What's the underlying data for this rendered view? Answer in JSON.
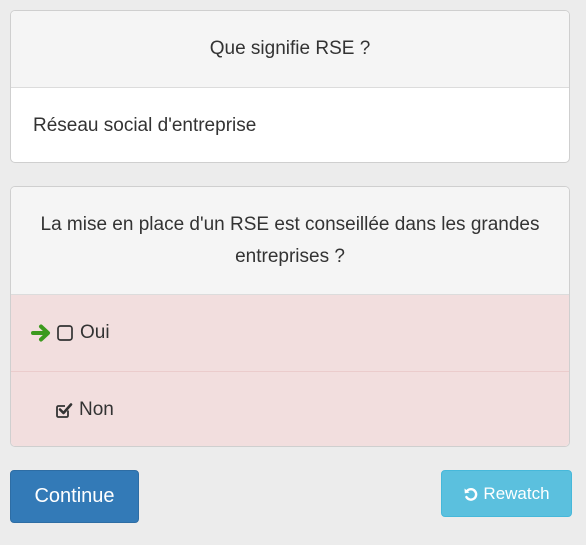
{
  "question_1": {
    "title": "Que signifie RSE ?",
    "answer": "Réseau social d'entreprise"
  },
  "question_2": {
    "title": "La mise en place d'un RSE est conseillée dans les grandes entreprises ?",
    "options": [
      {
        "label": "Oui",
        "checked": false,
        "indicator": "arrow-right-icon",
        "indicator_color": "#3c9a1e"
      },
      {
        "label": "Non",
        "checked": true
      }
    ],
    "status_background": "#f2dede"
  },
  "buttons": {
    "continue_label": "Continue",
    "rewatch_label": "Rewatch",
    "rewatch_icon": "undo-icon",
    "continue_color": "#337ab7",
    "rewatch_color": "#5bc0de"
  }
}
